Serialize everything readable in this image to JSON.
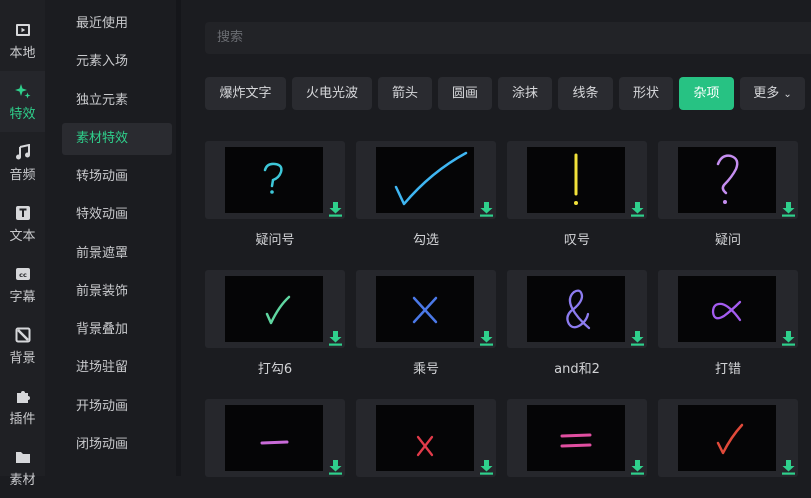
{
  "rail": [
    {
      "label": "本地",
      "icon": "film-icon"
    },
    {
      "label": "特效",
      "icon": "sparkle-icon",
      "active": true
    },
    {
      "label": "音频",
      "icon": "music-note-icon"
    },
    {
      "label": "文本",
      "icon": "text-t-icon"
    },
    {
      "label": "字幕",
      "icon": "cc-icon"
    },
    {
      "label": "背景",
      "icon": "background-slash-icon"
    },
    {
      "label": "插件",
      "icon": "puzzle-icon"
    },
    {
      "label": "素材",
      "icon": "folder-icon"
    }
  ],
  "submenu": [
    {
      "label": "最近使用"
    },
    {
      "label": "元素入场"
    },
    {
      "label": "独立元素"
    },
    {
      "label": "素材特效",
      "active": true
    },
    {
      "label": "转场动画"
    },
    {
      "label": "特效动画"
    },
    {
      "label": "前景遮罩"
    },
    {
      "label": "前景装饰"
    },
    {
      "label": "背景叠加"
    },
    {
      "label": "进场驻留"
    },
    {
      "label": "开场动画"
    },
    {
      "label": "闭场动画"
    }
  ],
  "search": {
    "placeholder": "搜索"
  },
  "tabs": [
    {
      "label": "爆炸文字"
    },
    {
      "label": "火电光波"
    },
    {
      "label": "箭头"
    },
    {
      "label": "圆画"
    },
    {
      "label": "涂抹"
    },
    {
      "label": "线条"
    },
    {
      "label": "形状"
    },
    {
      "label": "杂项",
      "active": true
    },
    {
      "label": "更多"
    }
  ],
  "cards": [
    {
      "label": "疑问号",
      "glyph": "question-small-icon",
      "color": "#3ec7d8"
    },
    {
      "label": "勾选",
      "glyph": "checkmark-large-icon",
      "color": "#3fb6f2"
    },
    {
      "label": "叹号",
      "glyph": "exclamation-icon",
      "color": "#f2e23a"
    },
    {
      "label": "疑问",
      "glyph": "question-large-icon",
      "color": "#c58ef0"
    },
    {
      "label": "打勾6",
      "glyph": "checkmark-small-icon",
      "color": "#5fd6a0"
    },
    {
      "label": "乘号",
      "glyph": "cross-icon",
      "color": "#4b79e8"
    },
    {
      "label": "and和2",
      "glyph": "ampersand-icon",
      "color": "#8d7cf0"
    },
    {
      "label": "打错",
      "glyph": "alpha-icon",
      "color": "#a45cf0"
    },
    {
      "label": "",
      "glyph": "dash-icon",
      "color": "#c96bd8"
    },
    {
      "label": "",
      "glyph": "cross-small-icon",
      "color": "#e23b4a"
    },
    {
      "label": "",
      "glyph": "equals-icon",
      "color": "#e04fa0"
    },
    {
      "label": "",
      "glyph": "checkmark-red-icon",
      "color": "#e04a3a"
    }
  ],
  "download_color": "#2fd08c"
}
